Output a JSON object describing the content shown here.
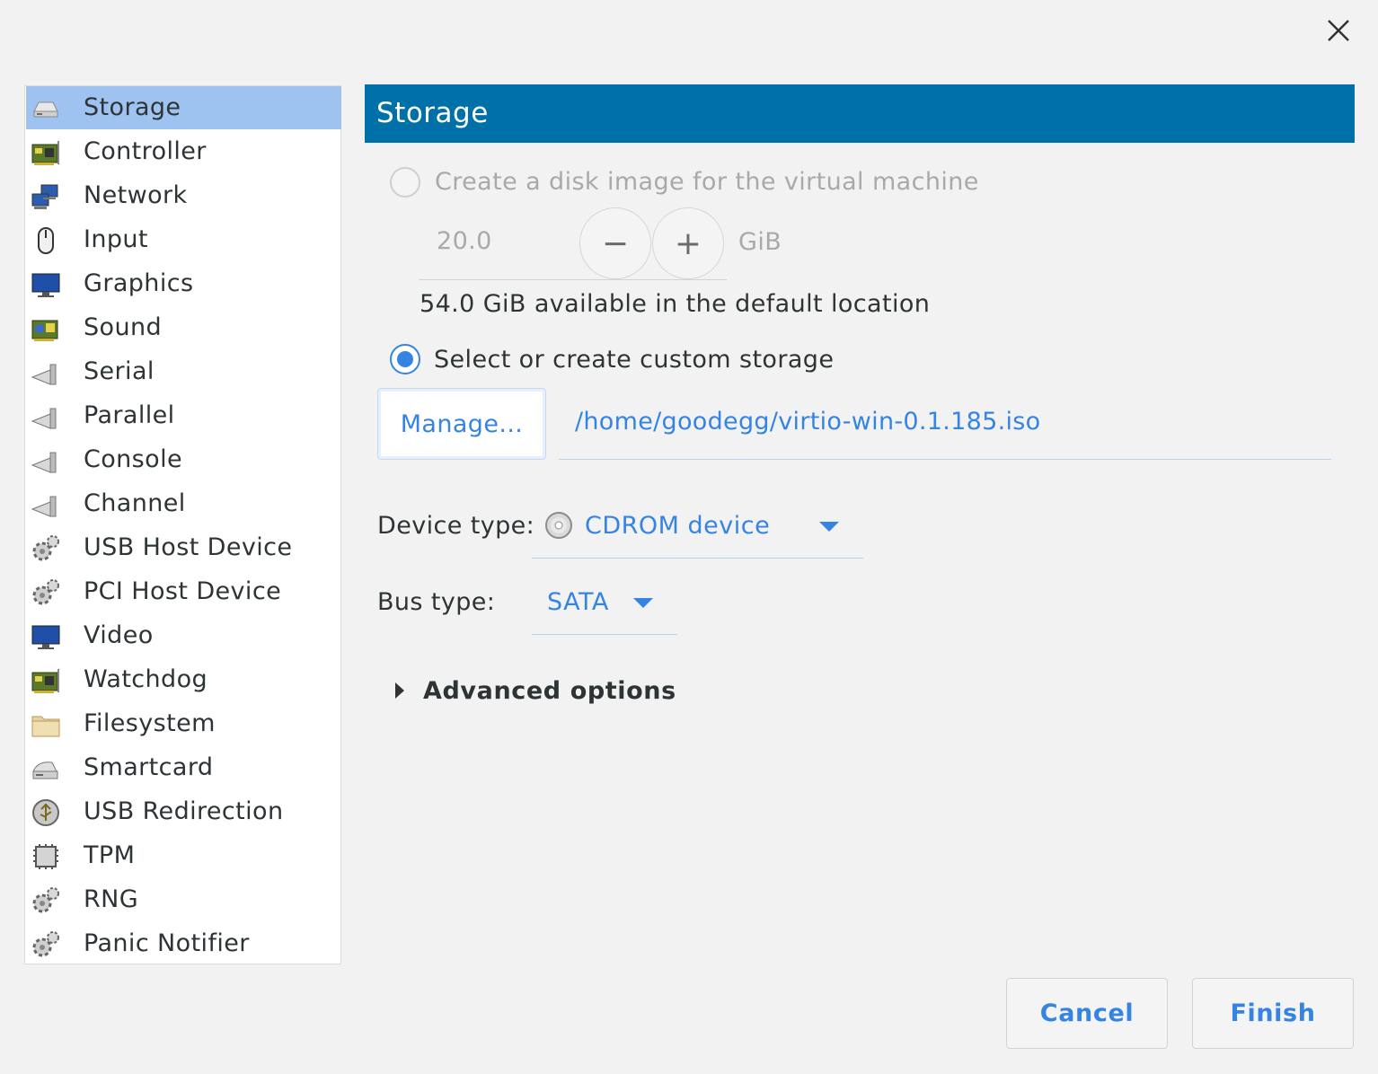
{
  "window": {
    "close_icon": "close-icon"
  },
  "sidebar": {
    "items": [
      {
        "label": "Storage",
        "icon": "harddisk-icon",
        "selected": true
      },
      {
        "label": "Controller",
        "icon": "controller-card-icon"
      },
      {
        "label": "Network",
        "icon": "network-icon"
      },
      {
        "label": "Input",
        "icon": "mouse-icon"
      },
      {
        "label": "Graphics",
        "icon": "monitor-icon"
      },
      {
        "label": "Sound",
        "icon": "sound-card-icon"
      },
      {
        "label": "Serial",
        "icon": "serial-port-icon"
      },
      {
        "label": "Parallel",
        "icon": "parallel-port-icon"
      },
      {
        "label": "Console",
        "icon": "console-port-icon"
      },
      {
        "label": "Channel",
        "icon": "channel-port-icon"
      },
      {
        "label": "USB Host Device",
        "icon": "usb-host-gear-icon"
      },
      {
        "label": "PCI Host Device",
        "icon": "pci-host-gear-icon"
      },
      {
        "label": "Video",
        "icon": "video-monitor-icon"
      },
      {
        "label": "Watchdog",
        "icon": "watchdog-card-icon"
      },
      {
        "label": "Filesystem",
        "icon": "folder-icon"
      },
      {
        "label": "Smartcard",
        "icon": "smartcard-reader-icon"
      },
      {
        "label": "USB Redirection",
        "icon": "usb-redirection-icon"
      },
      {
        "label": "TPM",
        "icon": "tpm-chip-icon"
      },
      {
        "label": "RNG",
        "icon": "rng-gear-icon"
      },
      {
        "label": "Panic Notifier",
        "icon": "panic-notifier-gear-icon"
      }
    ]
  },
  "panel": {
    "title": "Storage",
    "create_disk": {
      "label": "Create a disk image for the virtual machine",
      "selected": false,
      "size_value": "20.0",
      "unit": "GiB",
      "decrease_symbol": "−",
      "increase_symbol": "+",
      "available_text": "54.0 GiB available in the default location"
    },
    "custom_storage": {
      "label": "Select or create custom storage",
      "selected": true,
      "manage_label": "Manage...",
      "path": "/home/goodegg/virtio-win-0.1.185.iso"
    },
    "device_type": {
      "label": "Device type:",
      "value": "CDROM device",
      "icon": "cdrom-disc-icon"
    },
    "bus_type": {
      "label": "Bus type:",
      "value": "SATA"
    },
    "advanced": {
      "label": "Advanced options",
      "expanded": false
    }
  },
  "actions": {
    "cancel": "Cancel",
    "finish": "Finish"
  },
  "colors": {
    "accent": "#3584e4",
    "header_bg": "#0071a8",
    "selection_bg": "#9fc3f0"
  }
}
